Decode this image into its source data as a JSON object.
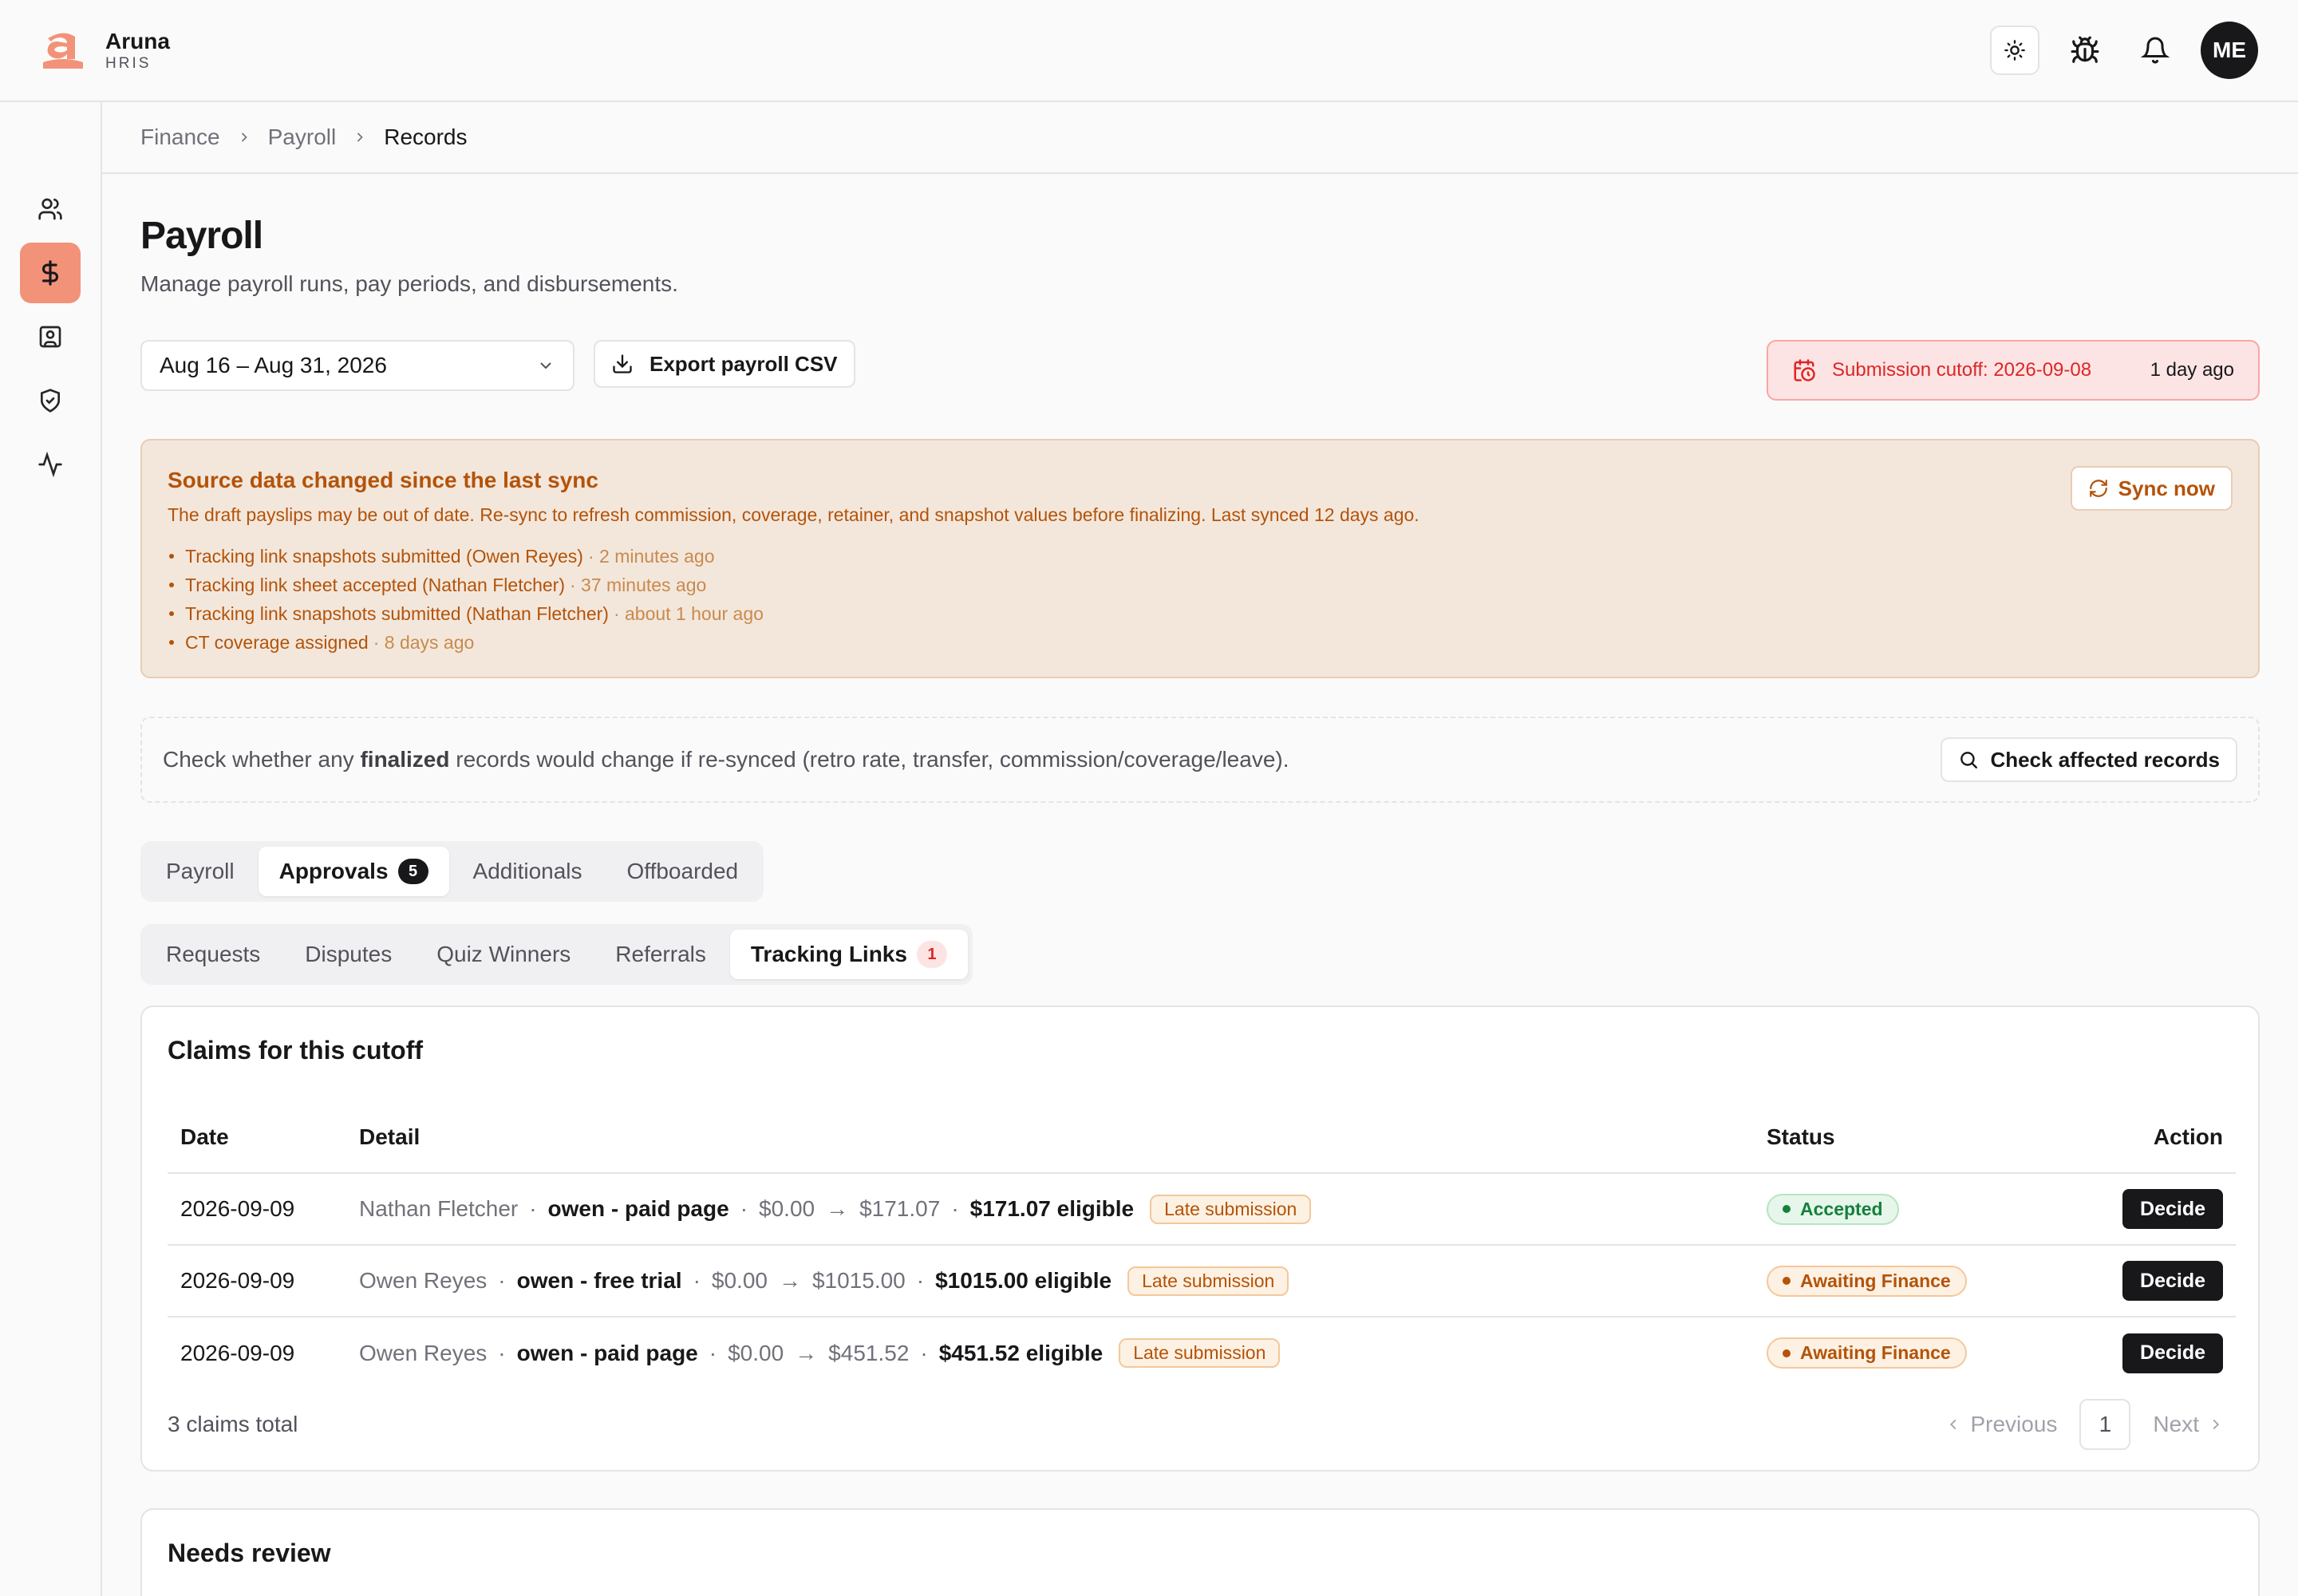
{
  "app": {
    "name": "Aruna",
    "subtitle": "HRIS",
    "avatar_initials": "ME"
  },
  "topbar_icons": [
    "sun-icon",
    "bug-icon",
    "bell-icon"
  ],
  "sidebar": {
    "items": [
      {
        "icon": "users-icon",
        "active": false
      },
      {
        "icon": "dollar-icon",
        "active": true
      },
      {
        "icon": "contact-card-icon",
        "active": false
      },
      {
        "icon": "shield-check-icon",
        "active": false
      },
      {
        "icon": "activity-icon",
        "active": false
      }
    ]
  },
  "breadcrumb": [
    "Finance",
    "Payroll",
    "Records"
  ],
  "page": {
    "title": "Payroll",
    "subtitle": "Manage payroll runs, pay periods, and disbursements."
  },
  "controls": {
    "period_value": "Aug 16 – Aug 31, 2026",
    "export_label": "Export payroll CSV",
    "cutoff_label": "Submission cutoff: 2026-09-08",
    "cutoff_ago": "1 day ago"
  },
  "alert": {
    "title": "Source data changed since the last sync",
    "description": "The draft payslips may be out of date. Re-sync to refresh commission, coverage, retainer, and snapshot values before finalizing. Last synced 12 days ago.",
    "sync_label": "Sync now",
    "items": [
      {
        "text": "Tracking link snapshots submitted (Owen Reyes)",
        "time": "· 2 minutes ago"
      },
      {
        "text": "Tracking link sheet accepted (Nathan Fletcher)",
        "time": "· 37 minutes ago"
      },
      {
        "text": "Tracking link snapshots submitted (Nathan Fletcher)",
        "time": "· about 1 hour ago"
      },
      {
        "text": "CT coverage assigned",
        "time": "· 8 days ago"
      }
    ]
  },
  "check": {
    "text_before": "Check whether any",
    "text_bold": "finalized",
    "text_after": "records would change if re-synced (retro rate, transfer, commission/coverage/leave).",
    "button_label": "Check affected records"
  },
  "tabs": [
    {
      "label": "Payroll",
      "active": false
    },
    {
      "label": "Approvals",
      "active": true,
      "badge": "5"
    },
    {
      "label": "Additionals",
      "active": false
    },
    {
      "label": "Offboarded",
      "active": false
    }
  ],
  "subtabs": [
    {
      "label": "Requests",
      "active": false
    },
    {
      "label": "Disputes",
      "active": false
    },
    {
      "label": "Quiz Winners",
      "active": false
    },
    {
      "label": "Referrals",
      "active": false
    },
    {
      "label": "Tracking Links",
      "active": true,
      "badge": "1"
    }
  ],
  "claims": {
    "title": "Claims for this cutoff",
    "columns": {
      "date": "Date",
      "detail": "Detail",
      "status": "Status",
      "action": "Action"
    },
    "rows": [
      {
        "date": "2026-09-09",
        "person": "Nathan Fletcher",
        "link": "owen - paid page",
        "from": "$0.00",
        "arrow": "→",
        "to": "$171.07",
        "eligible": "$171.07 eligible",
        "flag": "Late submission",
        "status": "Accepted",
        "status_kind": "accepted",
        "action": "Decide"
      },
      {
        "date": "2026-09-09",
        "person": "Owen Reyes",
        "link": "owen - free trial",
        "from": "$0.00",
        "arrow": "→",
        "to": "$1015.00",
        "eligible": "$1015.00 eligible",
        "flag": "Late submission",
        "status": "Awaiting Finance",
        "status_kind": "awaiting",
        "action": "Decide"
      },
      {
        "date": "2026-09-09",
        "person": "Owen Reyes",
        "link": "owen - paid page",
        "from": "$0.00",
        "arrow": "→",
        "to": "$451.52",
        "eligible": "$451.52 eligible",
        "flag": "Late submission",
        "status": "Awaiting Finance",
        "status_kind": "awaiting",
        "action": "Decide"
      }
    ],
    "total": "3 claims total",
    "pager": {
      "previous": "Previous",
      "page": "1",
      "next": "Next"
    }
  },
  "needs_review": {
    "title": "Needs review"
  },
  "colors": {
    "brand": "#f29279",
    "accent_dark": "#18181b",
    "warning": "#b45309",
    "danger": "#dc2626",
    "success": "#15803d"
  }
}
